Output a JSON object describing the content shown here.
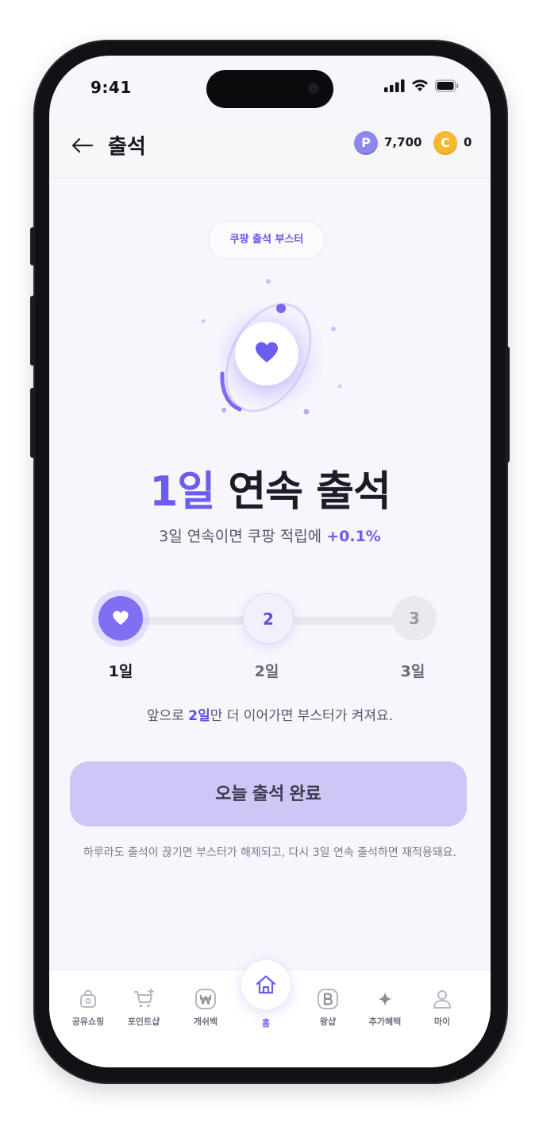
{
  "status_bar": {
    "time": "9:41"
  },
  "header": {
    "title": "출석",
    "point_badge": "P",
    "points": "7,700",
    "coin_badge": "C",
    "coins": "0"
  },
  "booster_chip": "쿠팡 출석 부스터",
  "streak": {
    "days": "1일",
    "title_rest": " 연속 출석",
    "subtitle_pre": "3일 연속이면 쿠팡 적립에 ",
    "subtitle_bonus": "+0.1%"
  },
  "steps": [
    {
      "label": "1일",
      "state": "done"
    },
    {
      "label": "2일",
      "number": "2",
      "state": "current"
    },
    {
      "label": "3일",
      "number": "3",
      "state": "upcoming"
    }
  ],
  "progress_note": {
    "pre": "앞으로 ",
    "highlight": "2일",
    "post": "만 더 이어가면 부스터가 켜져요."
  },
  "action_button": "오늘 출석 완료",
  "footnote": "하루라도 출석이 끊기면 부스터가 해제되고, 다시 3일 연속 출석하면 재적용돼요.",
  "tabs": [
    {
      "label": "공유쇼핑",
      "icon": "shopping-bag-icon"
    },
    {
      "label": "포인트샵",
      "icon": "cart-plus-icon"
    },
    {
      "label": "개쉬백",
      "icon": "won-coin-icon"
    },
    {
      "label": "홈",
      "icon": "home-icon",
      "active": true
    },
    {
      "label": "왕샵",
      "icon": "b-badge-icon"
    },
    {
      "label": "추가혜택",
      "icon": "sparkle-icon"
    },
    {
      "label": "마이",
      "icon": "person-icon"
    }
  ],
  "colors": {
    "accent": "#6a5df0",
    "button_bg": "#cdc7f6",
    "point_badge": "#8d87ef",
    "coin_badge": "#f6b82c"
  }
}
